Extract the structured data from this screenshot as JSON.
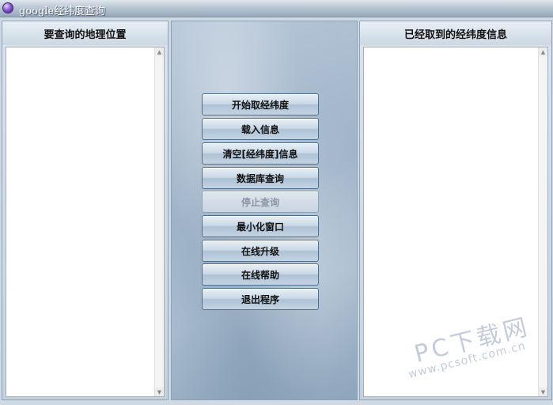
{
  "window": {
    "title": "google经纬度查询"
  },
  "left_panel": {
    "header": "要查询的地理位置"
  },
  "right_panel": {
    "header": "已经取到的经纬度信息"
  },
  "buttons": [
    {
      "label": "开始取经纬度",
      "enabled": true
    },
    {
      "label": "载入信息",
      "enabled": true
    },
    {
      "label": "清空[经纬度]信息",
      "enabled": true
    },
    {
      "label": "数据库查询",
      "enabled": true
    },
    {
      "label": "停止查询",
      "enabled": false
    },
    {
      "label": "最小化窗口",
      "enabled": true
    },
    {
      "label": "在线升级",
      "enabled": true
    },
    {
      "label": "在线帮助",
      "enabled": true
    },
    {
      "label": "退出程序",
      "enabled": true
    }
  ],
  "watermark": {
    "line1": "PC下载网",
    "line2": "www.pcsoft.com.cn"
  },
  "icons": {
    "app_icon": "purple-orb-icon",
    "scroll_up": "scroll-up-arrow-icon",
    "scroll_down": "scroll-down-arrow-icon"
  },
  "colors": {
    "panel_bg": "#c4d2e0",
    "button_border": "#4f6f8f",
    "disabled_text": "#8c96a3"
  }
}
